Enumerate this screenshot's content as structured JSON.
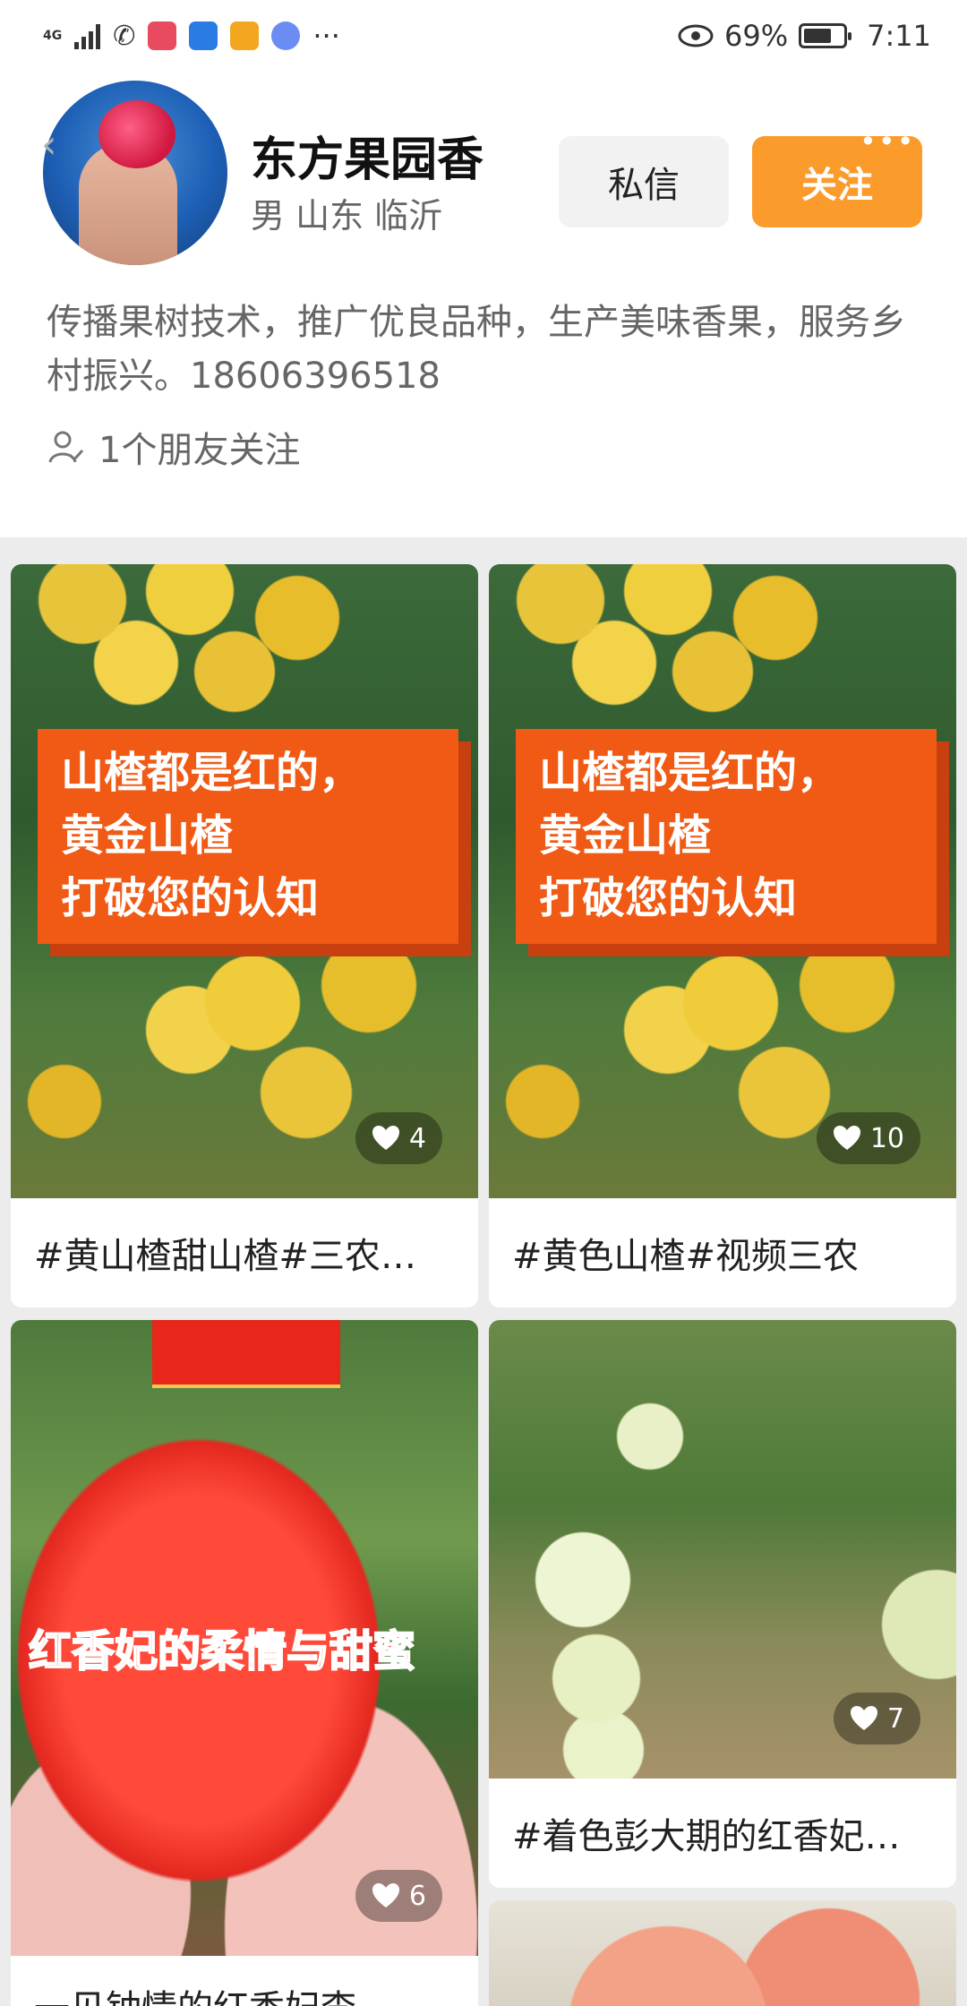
{
  "status_bar": {
    "network": "4G",
    "battery": "69%",
    "time": "7:11",
    "more": "···"
  },
  "profile": {
    "name": "东方果园香",
    "meta": "男 山东 临沂",
    "message_label": "私信",
    "follow_label": "关注",
    "more_label": "•••",
    "bio": "传播果树技术，推广优良品种，生产美味香果，服务乡村振兴。18606396518",
    "friends_text": "1个朋友关注"
  },
  "posts": [
    {
      "overlay_lines": [
        "山楂都是红的，",
        "黄金山楂",
        "打破您的认知"
      ],
      "likes": "4",
      "caption": "#黄山楂甜山楂#三农…"
    },
    {
      "overlay_lines": [
        "山楂都是红的，",
        "黄金山楂",
        "打破您的认知"
      ],
      "likes": "10",
      "caption": "#黄色山楂#视频三农"
    },
    {
      "overlay_text": "红香妃的柔情与甜蜜",
      "likes": "6",
      "caption": "一见钟情的红香妃李"
    },
    {
      "likes": "7",
      "caption": "#着色彭大期的红香妃…"
    }
  ]
}
